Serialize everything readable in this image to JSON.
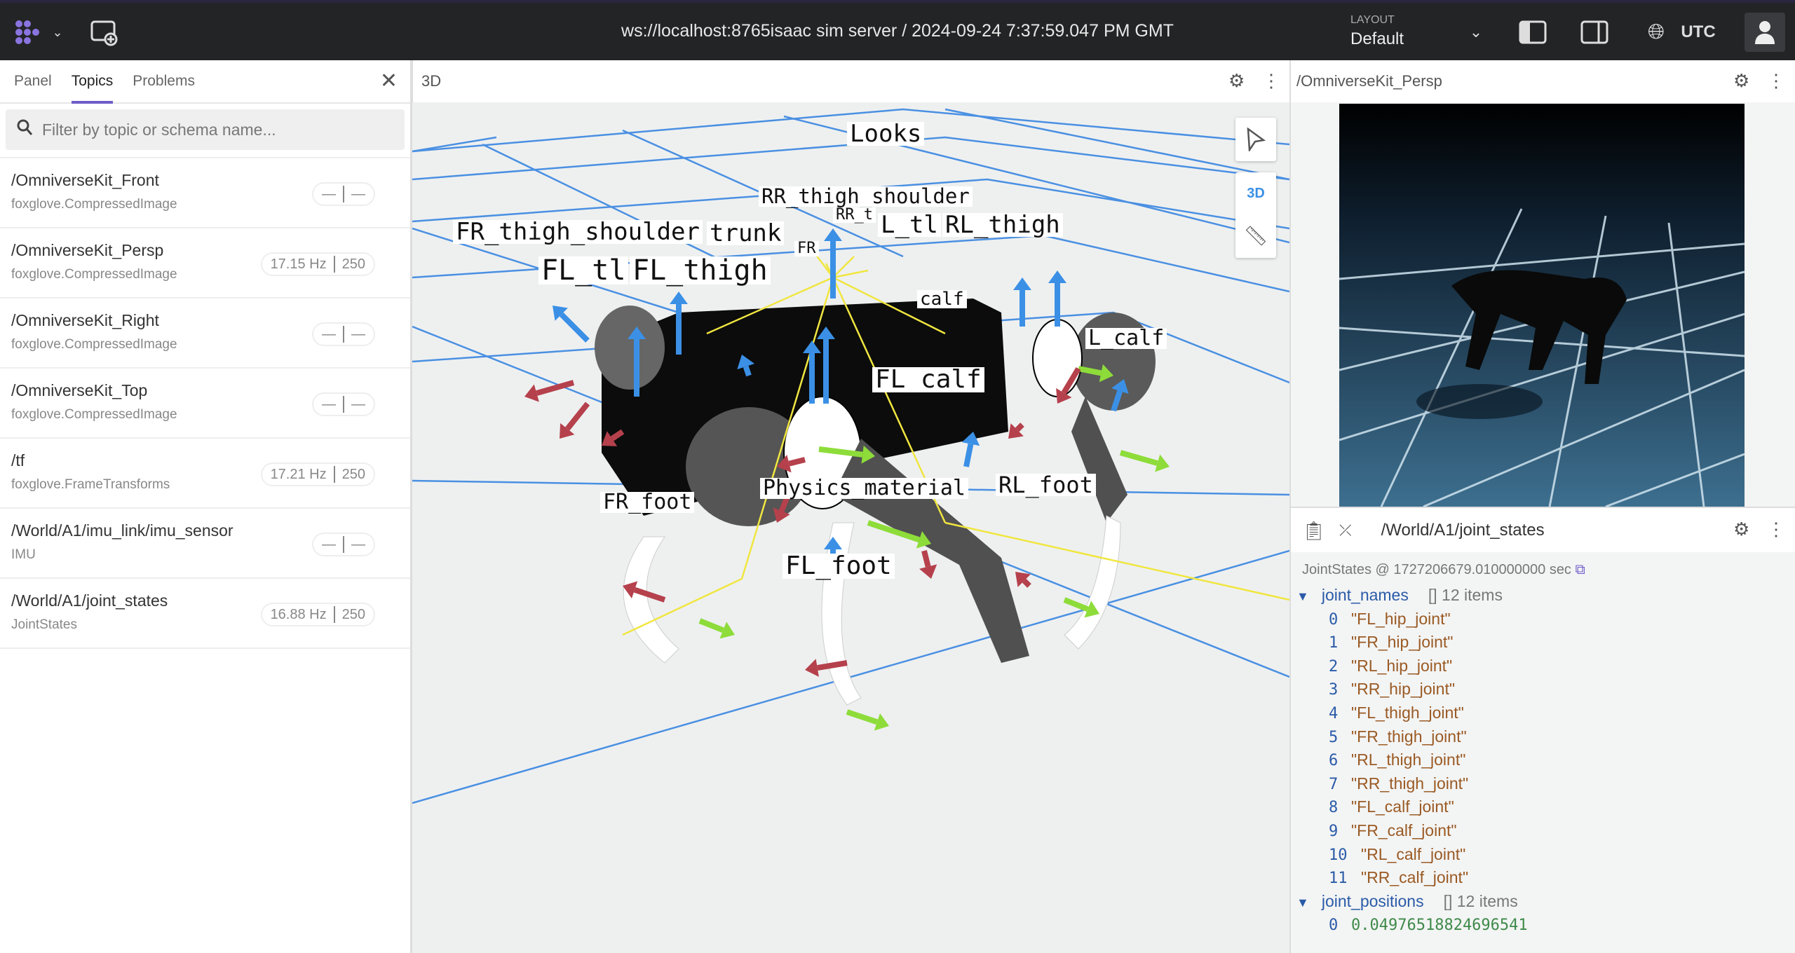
{
  "topbar": {
    "title": "ws://localhost:8765isaac sim server / 2024-09-24 7:37:59.047 PM GMT",
    "layout_label": "LAYOUT",
    "layout_value": "Default",
    "timezone": "UTC"
  },
  "left": {
    "tabs": [
      "Panel",
      "Topics",
      "Problems"
    ],
    "active_tab": "Topics",
    "search_placeholder": "Filter by topic or schema name...",
    "topics": [
      {
        "name": "/OmniverseKit_Front",
        "schema": "foxglove.CompressedImage",
        "hz": "—",
        "count": "—"
      },
      {
        "name": "/OmniverseKit_Persp",
        "schema": "foxglove.CompressedImage",
        "hz": "17.15 Hz",
        "count": "250"
      },
      {
        "name": "/OmniverseKit_Right",
        "schema": "foxglove.CompressedImage",
        "hz": "—",
        "count": "—"
      },
      {
        "name": "/OmniverseKit_Top",
        "schema": "foxglove.CompressedImage",
        "hz": "—",
        "count": "—"
      },
      {
        "name": "/tf",
        "schema": "foxglove.FrameTransforms",
        "hz": "17.21 Hz",
        "count": "250"
      },
      {
        "name": "/World/A1/imu_link/imu_sensor",
        "schema": "IMU",
        "hz": "—",
        "count": "—"
      },
      {
        "name": "/World/A1/joint_states",
        "schema": "JointStates",
        "hz": "16.88 Hz",
        "count": "250"
      }
    ]
  },
  "panel3d": {
    "title": "3D",
    "mode": "3D",
    "labels": [
      "Looks",
      "RR_thigh_shoulder",
      "RR_t",
      "FR_thigh_shoulder",
      "trunk",
      "RL_thigh",
      "L_tl",
      "FR",
      "FL_tl",
      "FL_thigh",
      "FL_calf",
      "L_calf",
      "FR_foot",
      "Physics_material",
      "RL_foot",
      "FL_foot",
      "calf"
    ]
  },
  "persp": {
    "title": "/OmniverseKit_Persp"
  },
  "joint_states": {
    "title": "/World/A1/joint_states",
    "header": "JointStates @ 1727206679.010000000 sec",
    "names_key": "joint_names",
    "names_meta": "[]  12 items",
    "names": [
      "\"FL_hip_joint\"",
      "\"FR_hip_joint\"",
      "\"RL_hip_joint\"",
      "\"RR_hip_joint\"",
      "\"FL_thigh_joint\"",
      "\"FR_thigh_joint\"",
      "\"RL_thigh_joint\"",
      "\"RR_thigh_joint\"",
      "\"FL_calf_joint\"",
      "\"FR_calf_joint\"",
      "\"RL_calf_joint\"",
      "\"RR_calf_joint\""
    ],
    "positions_key": "joint_positions",
    "positions_meta": "[]  12 items",
    "positions": [
      "0.04976518824696541"
    ]
  },
  "colors": {
    "accent": "#6f5cc9",
    "topbar": "#232426",
    "grid": "#3b8be0",
    "x_axis": "#b5414c",
    "y_axis": "#8edc3a",
    "z_axis": "#3b90e6"
  }
}
